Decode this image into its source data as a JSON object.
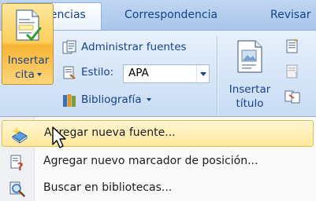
{
  "tabs": [
    {
      "label": "Referencias",
      "active": true
    },
    {
      "label": "Correspondencia",
      "active": false
    },
    {
      "label": "Revisar",
      "active": false
    }
  ],
  "ribbon": {
    "insert_citation": {
      "line1": "Insertar",
      "line2": "cita"
    },
    "manage_sources": "Administrar fuentes",
    "style_label": "Estilo:",
    "style_value": "APA",
    "bibliography": "Bibliografía",
    "insert_caption": {
      "line1": "Insertar",
      "line2": "título"
    }
  },
  "menu": {
    "items": [
      {
        "label": "Agregar nueva fuente...",
        "icon": "book-add-icon",
        "highlighted": true
      },
      {
        "label": "Agregar nuevo marcador de posición...",
        "icon": "placeholder-question-icon",
        "highlighted": false
      },
      {
        "label": "Buscar en bibliotecas...",
        "icon": "search-libraries-icon",
        "highlighted": false
      }
    ]
  },
  "colors": {
    "ribbon_text": "#15428b",
    "highlight": "#ffe79b",
    "pressed_button": "#fbcf5a"
  }
}
